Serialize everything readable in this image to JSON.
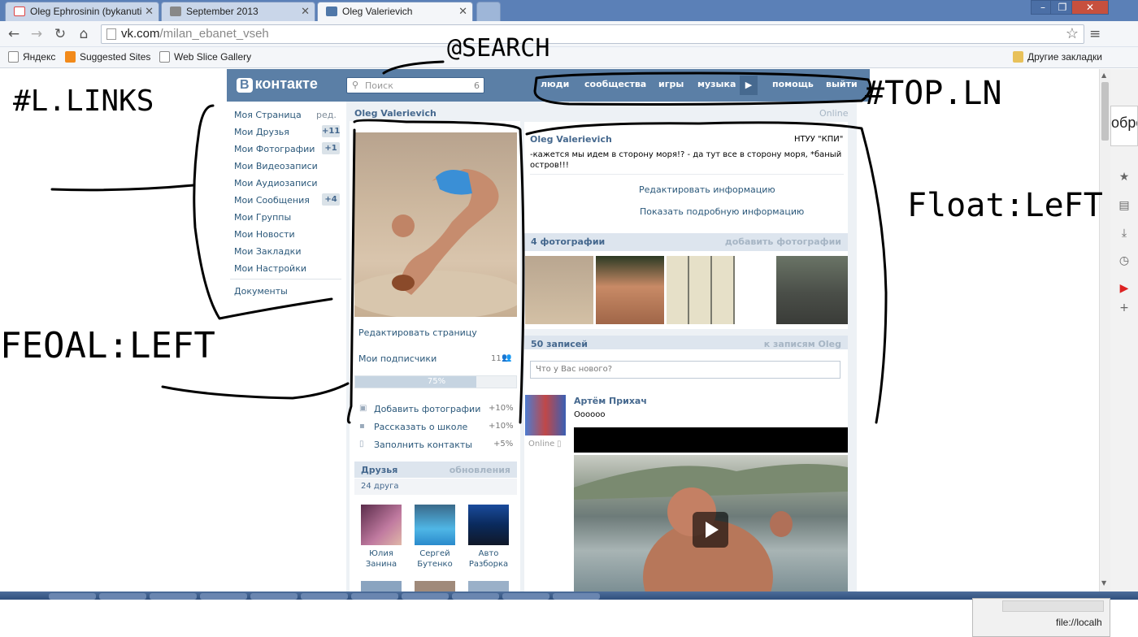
{
  "tabs": [
    {
      "label": "Oleg Ephrosinin (bykanuti",
      "color": "#d44"
    },
    {
      "label": "September 2013",
      "color": "#777"
    },
    {
      "label": "Oleg Valerievich",
      "color": "#4f77a8"
    }
  ],
  "address": {
    "host": "vk.com",
    "path": "/milan_ebanet_vseh"
  },
  "bookmarks": [
    "Яндекс",
    "Suggested Sites",
    "Web Slice Gallery"
  ],
  "bookmarks_other": "Другие закладки",
  "vk": {
    "logo": "контакте",
    "logo_letter": "В",
    "search_placeholder": "Поиск",
    "search_count": "6",
    "nav": [
      "люди",
      "сообщества",
      "игры",
      "музыка",
      "помощь",
      "выйти"
    ]
  },
  "left_menu": {
    "edit": "ред.",
    "items": [
      {
        "label": "Моя Страница",
        "badge": ""
      },
      {
        "label": "Мои Друзья",
        "badge": "+11"
      },
      {
        "label": "Мои Фотографии",
        "badge": "+1"
      },
      {
        "label": "Мои Видеозаписи",
        "badge": ""
      },
      {
        "label": "Мои Аудиозаписи",
        "badge": ""
      },
      {
        "label": "Мои Сообщения",
        "badge": "+4"
      },
      {
        "label": "Мои Группы",
        "badge": ""
      },
      {
        "label": "Мои Новости",
        "badge": ""
      },
      {
        "label": "Мои Закладки",
        "badge": ""
      },
      {
        "label": "Мои Настройки",
        "badge": ""
      }
    ],
    "docs": "Документы"
  },
  "profile": {
    "name": "Oleg Valerievich",
    "online": "Online",
    "edit_page": "Редактировать страницу",
    "followers_label": "Мои подписчики",
    "followers_count": "11",
    "progress_text": "75%",
    "progress_value": 0.75,
    "tasks": [
      {
        "label": "Добавить фотографии",
        "gain": "+10%"
      },
      {
        "label": "Рассказать о школе",
        "gain": "+10%"
      },
      {
        "label": "Заполнить контакты",
        "gain": "+5%"
      }
    ],
    "friends_title": "Друзья",
    "friends_updates": "обновления",
    "friends_count": "24 друга",
    "friends": [
      {
        "first": "Юлия",
        "last": "Занина"
      },
      {
        "first": "Сергей",
        "last": "Бутенко"
      },
      {
        "first": "Авто",
        "last": "Разборка"
      }
    ]
  },
  "info": {
    "name": "Oleg Valerievich",
    "university": "НТУУ \"КПИ\"",
    "status": "-кажется мы идем в сторону моря!? - да тут все в сторону моря, *баный остров!!!",
    "edit_info": "Редактировать информацию",
    "show_info": "Показать подробную информацию",
    "photos_title": "4 фотографии",
    "add_photos": "добавить фотографии",
    "wall_count": "50 записей",
    "wall_link": "к записям Oleg",
    "wall_placeholder": "Что у Вас нового?",
    "post_author": "Артём Прихач",
    "post_text": "Оооооо",
    "post_online": "Online"
  },
  "annotations": {
    "search": "@SEARCH",
    "links": "#L.LINKS",
    "top": "#TOP.LN",
    "float_right": "Float:LeFT",
    "float_left": "FEOAL:LEFT"
  },
  "popup_url": "file://localh",
  "ext_tab_text": "обре"
}
